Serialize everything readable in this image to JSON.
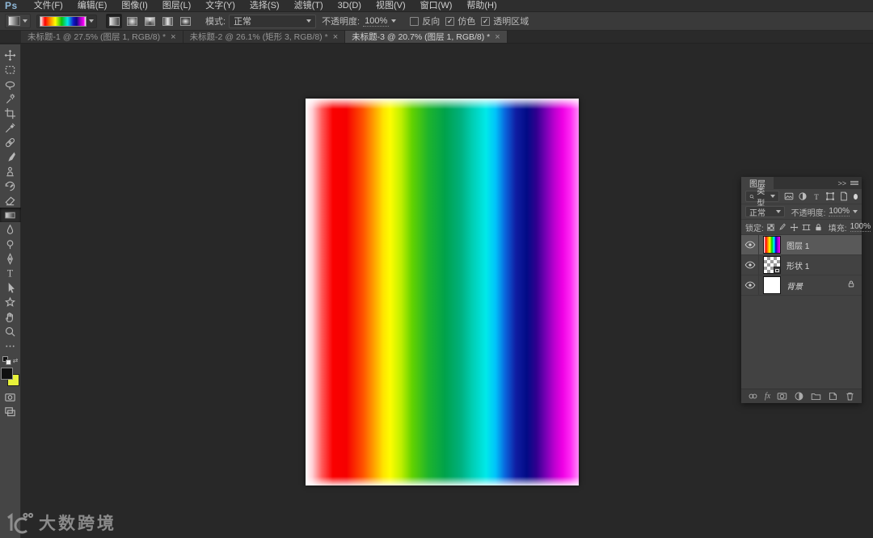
{
  "app": {
    "logo": "Ps"
  },
  "menubar": {
    "items": [
      "文件(F)",
      "编辑(E)",
      "图像(I)",
      "图层(L)",
      "文字(Y)",
      "选择(S)",
      "滤镜(T)",
      "3D(D)",
      "视图(V)",
      "窗口(W)",
      "帮助(H)"
    ]
  },
  "options": {
    "mode_label": "模式:",
    "mode_value": "正常",
    "opacity_label": "不透明度:",
    "opacity_value": "100%",
    "reverse_label": "反向",
    "reverse_checked": false,
    "dither_label": "仿色",
    "dither_checked": true,
    "transparency_label": "透明区域",
    "transparency_checked": true,
    "gradient_types": [
      "linear",
      "radial",
      "angle",
      "reflected",
      "diamond"
    ],
    "active_gradient_type": "linear"
  },
  "tabs": [
    {
      "title": "未标题-1 @ 27.5% (图层 1, RGB/8) *",
      "close": "×",
      "active": false
    },
    {
      "title": "未标题-2 @ 26.1% (矩形 3, RGB/8) *",
      "close": "×",
      "active": false
    },
    {
      "title": "未标题-3 @ 20.7% (图层 1, RGB/8) *",
      "close": "×",
      "active": true
    }
  ],
  "toolbar": {
    "tools": [
      "move",
      "rectangular-marquee",
      "lasso",
      "magic-wand",
      "crop",
      "eyedropper",
      "spot-healing",
      "brush",
      "clone-stamp",
      "history-brush",
      "eraser",
      "gradient",
      "blur",
      "dodge",
      "pen",
      "type",
      "path-selection",
      "custom-shape",
      "hand",
      "zoom",
      "more-tools"
    ],
    "selected_tool": "gradient",
    "foreground_color": "#101010",
    "background_color": "#e8f23a"
  },
  "layers_panel": {
    "title": "图层",
    "collapse": ">>",
    "filter_label": "类型",
    "blend_mode": "正常",
    "opacity_label": "不透明度:",
    "opacity_value": "100%",
    "lock_label": "锁定:",
    "fill_label": "填充:",
    "fill_value": "100%",
    "layers": [
      {
        "name": "图层 1",
        "selected": true,
        "thumb": "rainbow",
        "visible": true,
        "locked": false
      },
      {
        "name": "形状 1",
        "selected": false,
        "thumb": "checker",
        "visible": true,
        "locked": false
      },
      {
        "name": "背景",
        "selected": false,
        "thumb": "white",
        "visible": true,
        "locked": true
      }
    ]
  },
  "watermark": {
    "brand": "大数跨境",
    "logo_icon": "googol-power-logo"
  }
}
